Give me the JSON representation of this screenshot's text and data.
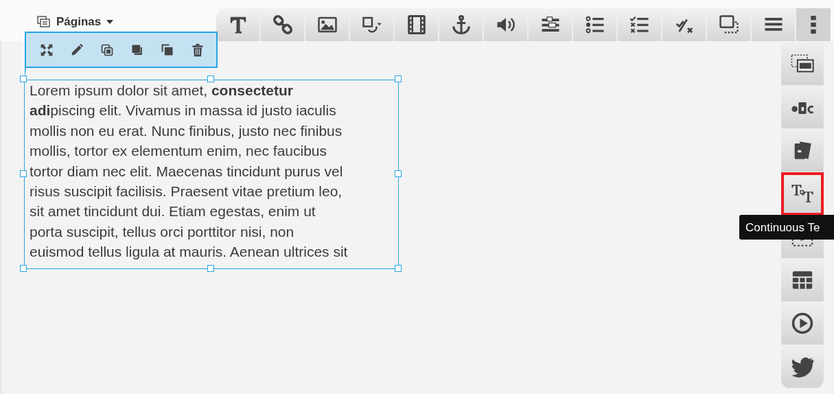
{
  "pages_menu": {
    "label": "Páginas"
  },
  "toolbar": [
    {
      "kind": "text",
      "selected": false
    },
    {
      "kind": "link",
      "selected": false
    },
    {
      "kind": "image",
      "selected": false
    },
    {
      "kind": "shape",
      "selected": false
    },
    {
      "kind": "video",
      "selected": false
    },
    {
      "kind": "anchor",
      "selected": false
    },
    {
      "kind": "audio",
      "selected": false
    },
    {
      "kind": "form",
      "selected": false
    },
    {
      "kind": "radiolist",
      "selected": false
    },
    {
      "kind": "checklist",
      "selected": false
    },
    {
      "kind": "quiz",
      "selected": false
    },
    {
      "kind": "popup",
      "selected": false
    },
    {
      "kind": "list",
      "selected": false
    },
    {
      "kind": "more",
      "selected": true
    }
  ],
  "object_toolbar": [
    {
      "kind": "expand"
    },
    {
      "kind": "edit"
    },
    {
      "kind": "duplicate"
    },
    {
      "kind": "front"
    },
    {
      "kind": "back"
    },
    {
      "kind": "delete"
    }
  ],
  "text_block": {
    "text": "Lorem ipsum dolor sit amet, **consectetur**\n**adi**piscing elit. Vivamus in massa id justo iaculis\nmollis non eu erat. Nunc finibus, justo nec finibus\nmollis, tortor ex elementum enim, nec faucibus\ntortor diam nec elit. Maecenas tincidunt purus vel\nrisus suscipit facilisis. Praesent vitae pretium leo,\nsit amet tincidunt dui. Etiam egestas, enim ut\nporta suscipit, tellus orci porttitor nisi, non\neuismod tellus ligula at mauris. Aenean ultrices sit"
  },
  "side_toolbar": [
    {
      "kind": "textframe",
      "highlighted": false
    },
    {
      "kind": "abc",
      "highlighted": false
    },
    {
      "kind": "cards",
      "highlighted": false
    },
    {
      "kind": "continuous",
      "highlighted": true
    },
    {
      "kind": "editframe",
      "highlighted": false
    },
    {
      "kind": "table",
      "highlighted": false
    },
    {
      "kind": "play",
      "highlighted": false
    },
    {
      "kind": "bird",
      "highlighted": false
    }
  ],
  "tooltip": {
    "text": "Continuous Te"
  }
}
